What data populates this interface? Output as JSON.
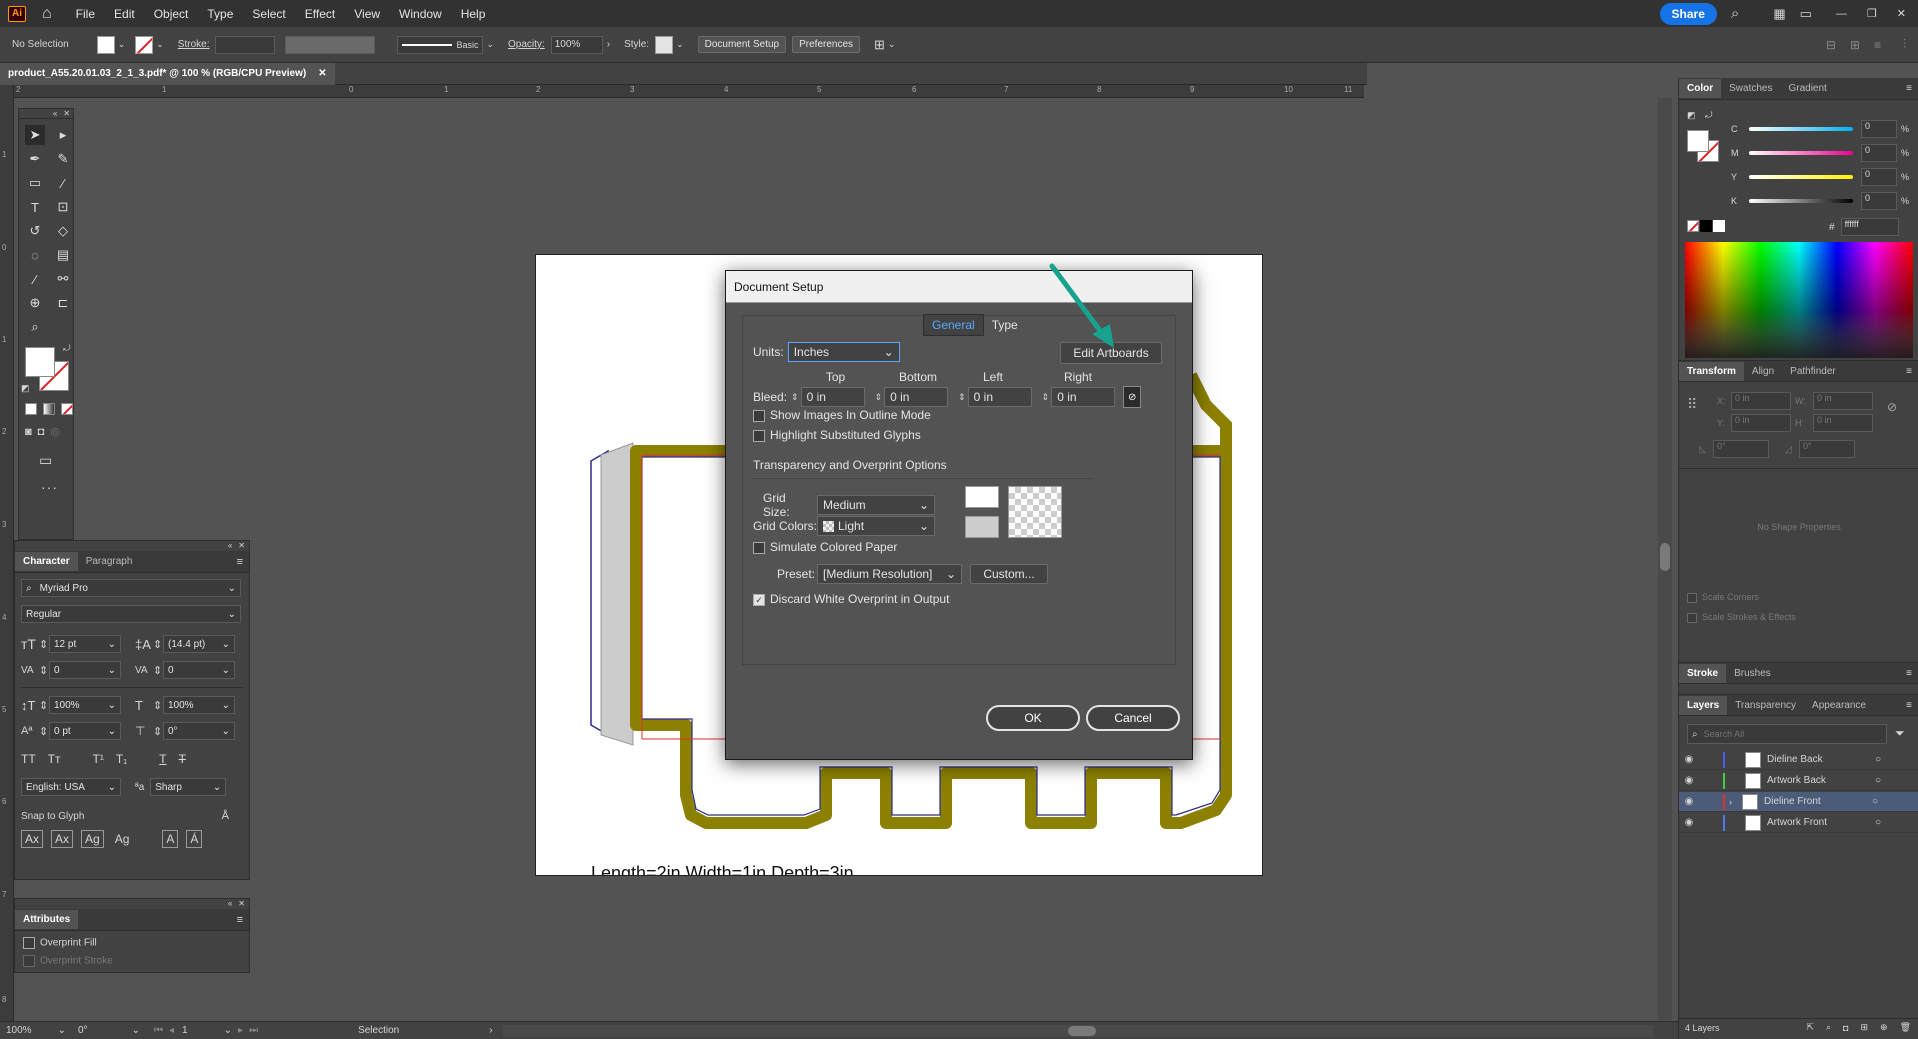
{
  "menubar": {
    "logo": "Ai",
    "items": [
      "File",
      "Edit",
      "Object",
      "Type",
      "Select",
      "Effect",
      "View",
      "Window",
      "Help"
    ],
    "share_label": "Share"
  },
  "controlbar": {
    "selection": "No Selection",
    "stroke_label": "Stroke:",
    "brush_label": "Basic",
    "opacity_label": "Opacity:",
    "opacity_value": "100%",
    "style_label": "Style:",
    "document_setup": "Document Setup",
    "preferences": "Preferences"
  },
  "document_tab": {
    "title": "product_A55.20.01.03_2_1_3.pdf* @ 100 % (RGB/CPU Preview)"
  },
  "ruler": {
    "h_ticks": [
      "2",
      "1",
      "0",
      "1",
      "2",
      "3",
      "4",
      "5",
      "6",
      "7",
      "8",
      "9",
      "10",
      "11"
    ],
    "v_ticks": [
      "1",
      "0",
      "1",
      "2",
      "3",
      "4",
      "5",
      "6",
      "7",
      "8"
    ]
  },
  "character_panel": {
    "tabs": [
      "Character",
      "Paragraph"
    ],
    "font_family": "Myriad Pro",
    "font_style": "Regular",
    "font_size": "12 pt",
    "leading": "(14.4 pt)",
    "kerning": "0",
    "tracking": "0",
    "vertical_scale": "100%",
    "horizontal_scale": "100%",
    "baseline_shift": "0 pt",
    "rotation": "0°",
    "language": "English: USA",
    "antialias": "Sharp",
    "snap_to_glyph": "Snap to Glyph"
  },
  "attributes_panel": {
    "title": "Attributes",
    "overprint_fill": "Overprint Fill",
    "overprint_stroke": "Overprint Stroke"
  },
  "color_panel": {
    "tabs": [
      "Color",
      "Swatches",
      "Gradient"
    ],
    "channels": [
      {
        "name": "C",
        "value": "0",
        "unit": "%"
      },
      {
        "name": "M",
        "value": "0",
        "unit": "%"
      },
      {
        "name": "Y",
        "value": "0",
        "unit": "%"
      },
      {
        "name": "K",
        "value": "0",
        "unit": "%"
      }
    ],
    "hex_value": "ffffff"
  },
  "transform_panel": {
    "tabs": [
      "Transform",
      "Align",
      "Pathfinder"
    ],
    "x_label": "X:",
    "x_value": "0 in",
    "y_label": "Y:",
    "y_value": "0 in",
    "w_label": "W:",
    "w_value": "0 in",
    "h_label": "H:",
    "h_value": "0 in",
    "angle": "0°",
    "shear": "0°",
    "no_shape": "No Shape Properties",
    "scale_corners": "Scale Corners",
    "scale_strokes": "Scale Strokes & Effects"
  },
  "stroke_panel": {
    "tabs": [
      "Stroke",
      "Brushes"
    ]
  },
  "layers_panel": {
    "tabs": [
      "Layers",
      "Transparency",
      "Appearance"
    ],
    "search_placeholder": "Search All",
    "layers": [
      {
        "name": "Dieline Back",
        "color": "#4a5cf0"
      },
      {
        "name": "Artwork Back",
        "color": "#3fd13f"
      },
      {
        "name": "Dieline Front",
        "color": "#e03030"
      },
      {
        "name": "Artwork Front",
        "color": "#4a7cf0"
      }
    ],
    "count": "4 Layers"
  },
  "artboard": {
    "caption": "Length=2in Width=1in Depth=3in"
  },
  "dialog": {
    "title": "Document Setup",
    "tabs": [
      "General",
      "Type"
    ],
    "units_label": "Units:",
    "units_value": "Inches",
    "edit_artboards": "Edit Artboards",
    "bleed_label": "Bleed:",
    "bleed_headers": [
      "Top",
      "Bottom",
      "Left",
      "Right"
    ],
    "bleed_values": [
      "0 in",
      "0 in",
      "0 in",
      "0 in"
    ],
    "show_images_outline": "Show Images In Outline Mode",
    "highlight_glyphs": "Highlight Substituted Glyphs",
    "section_title": "Transparency and Overprint Options",
    "grid_size_label": "Grid Size:",
    "grid_size_value": "Medium",
    "grid_colors_label": "Grid Colors:",
    "grid_colors_value": "Light",
    "simulate_paper": "Simulate Colored Paper",
    "preset_label": "Preset:",
    "preset_value": "[Medium Resolution]",
    "custom_button": "Custom...",
    "discard_white": "Discard White Overprint in Output",
    "ok": "OK",
    "cancel": "Cancel"
  },
  "statusbar": {
    "zoom": "100%",
    "rotation": "0°",
    "artboard_num": "1",
    "tool": "Selection"
  },
  "colors": {
    "accent": "#1473e6",
    "annotation_arrow": "#17a28e",
    "dieline_olive": "#8c8000",
    "dieline_blue": "#2a2a8c",
    "dieline_red": "#e03030"
  }
}
